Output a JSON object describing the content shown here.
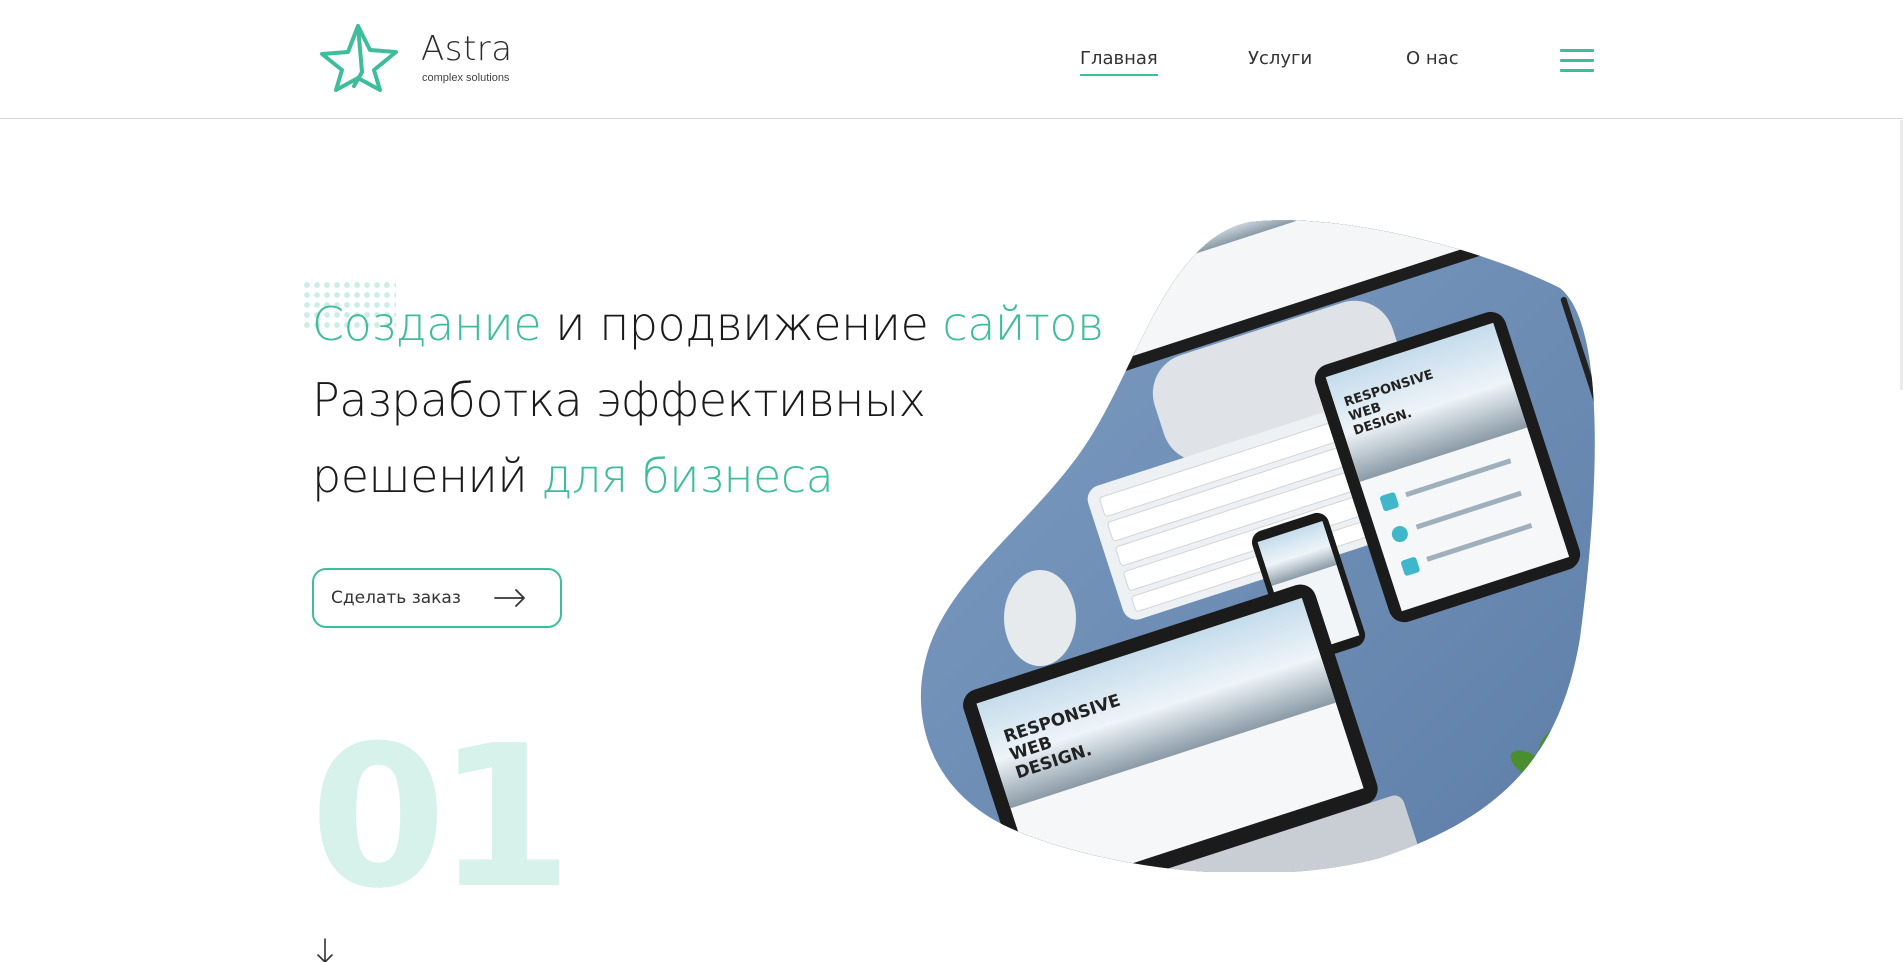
{
  "header": {
    "logo": {
      "name": "Astra",
      "tagline": "complex solutions",
      "icon": "star-outline-icon"
    },
    "nav": [
      {
        "label": "Главная",
        "active": true
      },
      {
        "label": "Услуги",
        "active": false
      },
      {
        "label": "О нас",
        "active": false
      }
    ],
    "menu_icon": "hamburger-menu-icon"
  },
  "hero": {
    "heading": {
      "line1": {
        "part1": "Создание",
        "part2": " и продвижение ",
        "part3": "сайтов"
      },
      "line2": "Разработка эффективных",
      "line3": {
        "part1": "решений ",
        "part2": "для бизнеса"
      }
    },
    "cta": {
      "label": "Сделать заказ",
      "icon": "arrow-right-icon"
    },
    "slide_number": "01",
    "scroll_icon": "arrow-down-icon",
    "image": {
      "description_texts": [
        "RESPONSIVE",
        "WEB",
        "DESIGN."
      ],
      "icon": "devices-photo"
    }
  },
  "colors": {
    "accent": "#3dbd9c",
    "accent_light": "#d6f2ea",
    "text": "#1a1a1a",
    "border": "#d9d9d9",
    "desk_blue": "#6f8fb5"
  }
}
